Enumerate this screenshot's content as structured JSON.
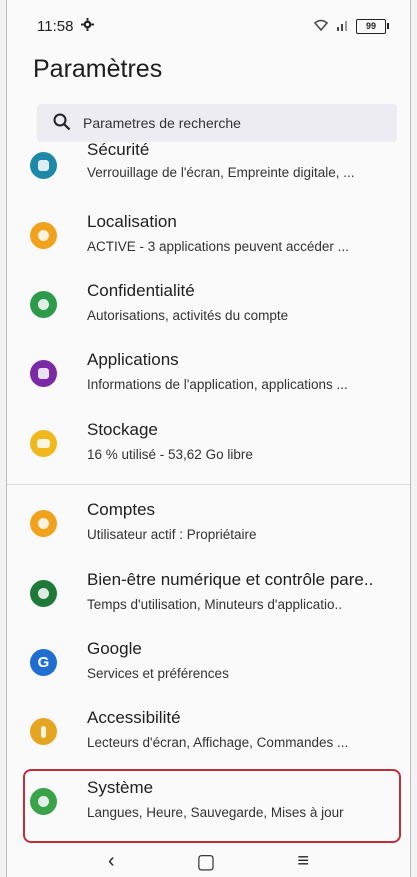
{
  "status": {
    "time": "11:58",
    "battery": "99"
  },
  "header": {
    "title": "Paramètres"
  },
  "search": {
    "placeholder": "Parametres de recherche"
  },
  "items": [
    {
      "title": "Sécurité",
      "subtitle": "Verrouillage de l'écran, Empreinte digitale, ...",
      "color": "#1e88a8",
      "icon": "lock-icon"
    },
    {
      "title": "Localisation",
      "subtitle": "ACTIVE - 3 applications peuvent accéder ...",
      "color": "#f0a21c",
      "icon": "location-icon"
    },
    {
      "title": "Confidentialité",
      "subtitle": "Autorisations, activités du compte",
      "color": "#2e9b4c",
      "icon": "privacy-icon"
    },
    {
      "title": "Applications",
      "subtitle": "Informations de l'application, applications ...",
      "color": "#7b2aa6",
      "icon": "apps-icon"
    },
    {
      "title": "Stockage",
      "subtitle": "16 % utilisé - 53,62 Go libre",
      "color": "#f0b81c",
      "icon": "storage-icon"
    },
    {
      "title": "Comptes",
      "subtitle": "Utilisateur actif : Propriétaire",
      "color": "#f0a21c",
      "icon": "account-icon"
    },
    {
      "title": "Bien-être numérique et contrôle pare..",
      "subtitle": "Temps d'utilisation, Minuteurs d'applicatio..",
      "color": "#1f7a3a",
      "icon": "wellbeing-icon"
    },
    {
      "title": "Google",
      "subtitle": "Services et préférences",
      "color": "#1f6fd1",
      "icon": "google-icon"
    },
    {
      "title": "Accessibilité",
      "subtitle": "Lecteurs d'écran, Affichage, Commandes ...",
      "color": "#e6a520",
      "icon": "accessibility-icon"
    },
    {
      "title": "Système",
      "subtitle": "Langues, Heure, Sauvegarde, Mises à jour",
      "color": "#3aa34a",
      "icon": "system-icon"
    }
  ],
  "navbar": {
    "back": "‹",
    "home": "▢",
    "recents": "≡"
  }
}
